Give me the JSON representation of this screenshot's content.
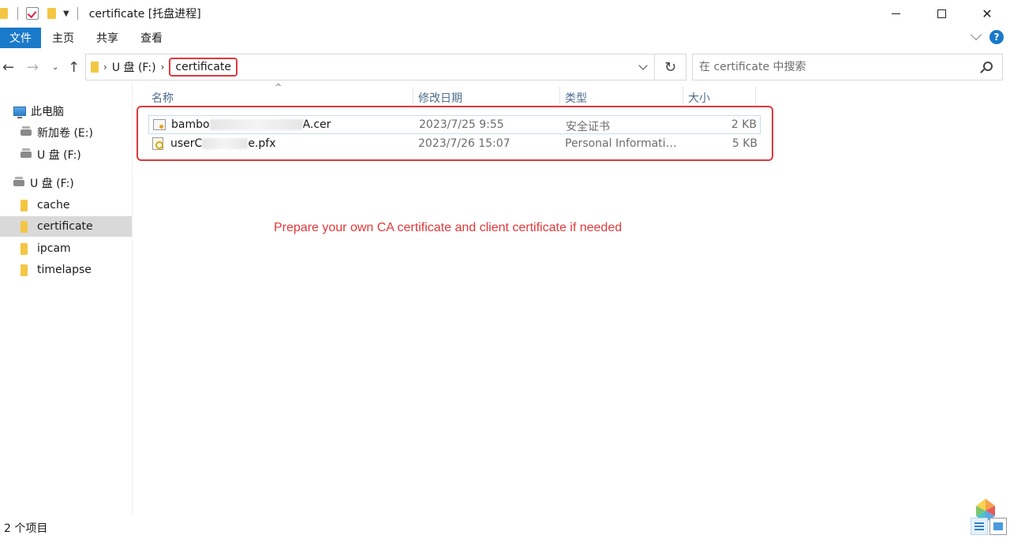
{
  "window": {
    "title": "certificate [托盘进程]"
  },
  "ribbon": {
    "tabs": [
      "文件",
      "主页",
      "共享",
      "查看"
    ],
    "help_label": "?"
  },
  "address": {
    "drive": "U 盘 (F:)",
    "current": "certificate",
    "search_placeholder": "在 certificate 中搜索"
  },
  "nav_pane": {
    "items": [
      {
        "label": "此电脑",
        "icon": "computer-icon"
      },
      {
        "label": "新加卷 (E:)",
        "icon": "drive-icon"
      },
      {
        "label": "U 盘 (F:)",
        "icon": "usb-drive-icon"
      },
      {
        "label": "U 盘 (F:)",
        "icon": "usb-drive-icon"
      },
      {
        "label": "cache",
        "icon": "folder-icon"
      },
      {
        "label": "certificate",
        "icon": "folder-icon",
        "selected": true
      },
      {
        "label": "ipcam",
        "icon": "folder-icon"
      },
      {
        "label": "timelapse",
        "icon": "folder-icon"
      }
    ]
  },
  "columns": {
    "name": "名称",
    "date": "修改日期",
    "type": "类型",
    "size": "大小"
  },
  "files": [
    {
      "name_start": "bambo",
      "name_end": "A.cer",
      "date": "2023/7/25 9:55",
      "type": "安全证书",
      "size": "2 KB",
      "icon": "certificate-icon"
    },
    {
      "name_start": "userC",
      "name_end": "e.pfx",
      "date": "2023/7/26 15:07",
      "type": "Personal Informatio...",
      "size": "5 KB",
      "icon": "pfx-key-icon"
    }
  ],
  "annotation": {
    "note": "Prepare your own CA certificate and client certificate if needed",
    "color": "#e0383a"
  },
  "status": {
    "item_count": "2 个项目"
  },
  "colors": {
    "accent": "#1979ca",
    "folder": "#f3c744"
  }
}
